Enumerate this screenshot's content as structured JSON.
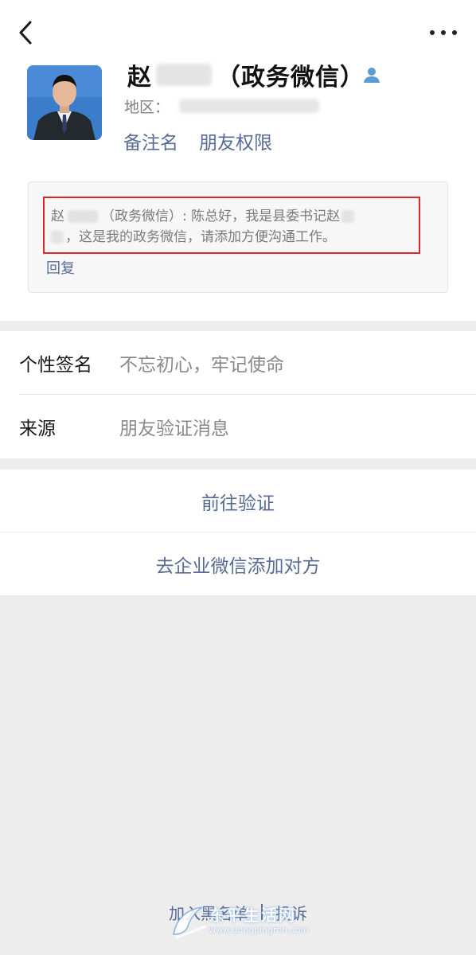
{
  "header": {
    "back_icon": "chevron-left-icon",
    "more_icon": "more-horizontal-icon"
  },
  "profile": {
    "name_visible": "赵",
    "name_suffix": "（政务微信）",
    "contact_icon": "person-icon",
    "region_label": "地区：",
    "remark_link": "备注名",
    "permission_link": "朋友权限"
  },
  "message": {
    "line1_prefix": "赵",
    "line1_text": "（政务微信）: 陈总好，我是县委书记赵",
    "line2_text": "，这是我的政务微信，请添加方便沟通工作。",
    "reply_label": "回复",
    "highlight_color": "#e0262d"
  },
  "info": {
    "signature_label": "个性签名",
    "signature_value": "不忘初心，牢记使命",
    "source_label": "来源",
    "source_value": "朋友验证消息"
  },
  "actions": {
    "verify_label": "前往验证",
    "wecom_label": "去企业微信添加对方"
  },
  "footer": {
    "blacklist_label": "加入黑名单",
    "complain_label": "投诉"
  },
  "watermark": {
    "title": "东平生活网",
    "url": "www.dongpingren.com"
  },
  "colors": {
    "link": "#576b95",
    "background": "#ededed"
  }
}
